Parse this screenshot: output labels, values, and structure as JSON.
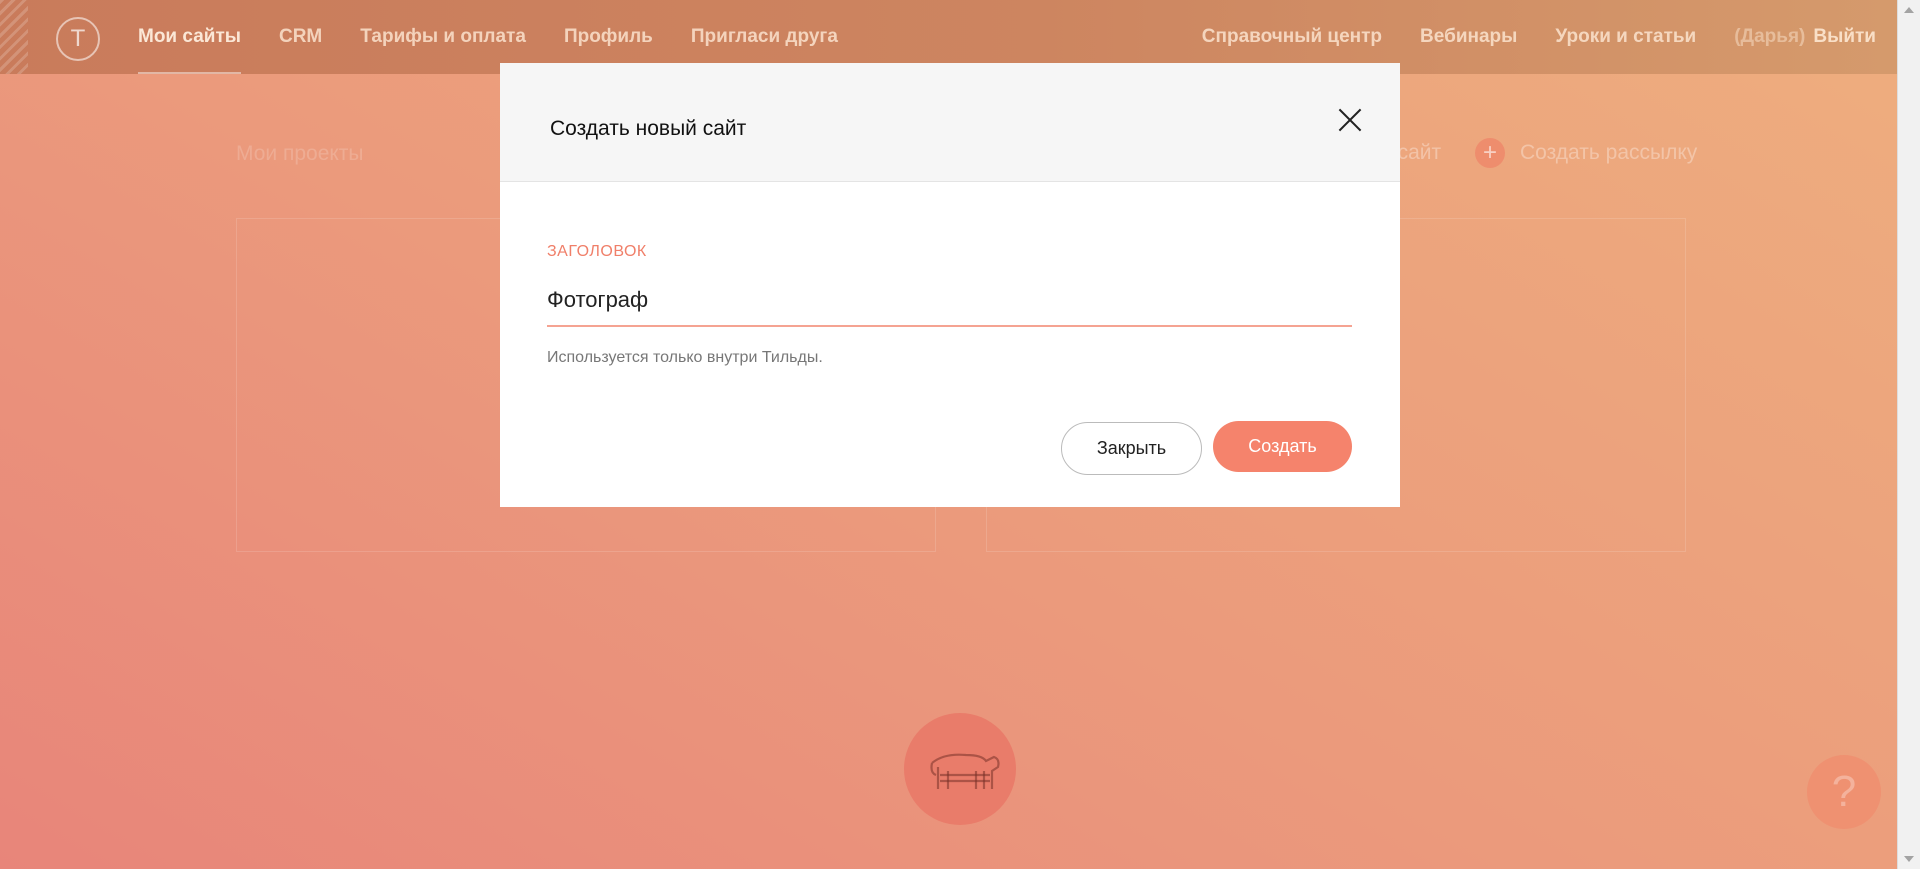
{
  "topnav": {
    "left_items": [
      "Мои сайты",
      "CRM",
      "Тарифы и оплата",
      "Профиль",
      "Пригласи друга"
    ],
    "right_items": [
      "Справочный центр",
      "Вебинары",
      "Уроки и статьи"
    ],
    "user_name": "(Дарья)",
    "logout": "Выйти"
  },
  "background": {
    "projects_title": "Мои проекты",
    "create_site_action": "й сайт",
    "create_mailing_action": "Создать рассылку"
  },
  "modal": {
    "title": "Создать новый сайт",
    "field_label": "ЗАГОЛОВОК",
    "field_value": "Фотограф",
    "hint": "Используется только внутри Тильды.",
    "close_label": "Закрыть",
    "create_label": "Создать"
  },
  "help": {
    "label": "?"
  },
  "colors": {
    "accent": "#f5836c",
    "label": "#f07f69"
  }
}
